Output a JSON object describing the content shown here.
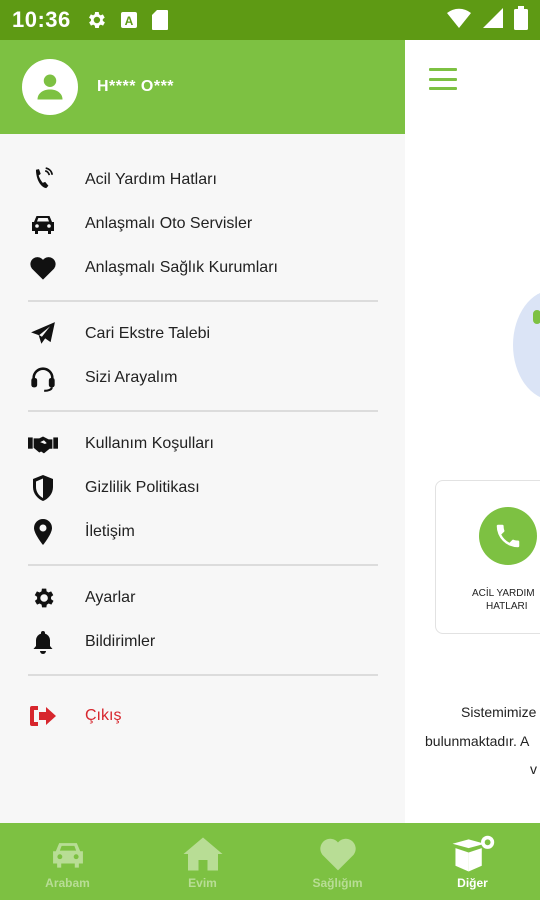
{
  "status_bar": {
    "time": "10:36",
    "icons": [
      "gear-icon",
      "a-badge-icon",
      "sd-card-icon",
      "wifi-icon",
      "signal-icon",
      "battery-icon"
    ]
  },
  "colors": {
    "brand_green": "#7dc142",
    "status_green": "#5e9a14",
    "logout_red": "#d7262d",
    "drawer_bg": "#f7f7f7"
  },
  "drawer": {
    "user_name": "H**** O***",
    "groups": [
      [
        {
          "label": "Acil Yardım Hatları",
          "icon": "phone-ring-icon"
        },
        {
          "label": "Anlaşmalı Oto Servisler",
          "icon": "car-icon"
        },
        {
          "label": "Anlaşmalı Sağlık Kurumları",
          "icon": "heart-icon"
        }
      ],
      [
        {
          "label": "Cari Ekstre Talebi",
          "icon": "paper-plane-icon"
        },
        {
          "label": "Sizi Arayalım",
          "icon": "headset-icon"
        }
      ],
      [
        {
          "label": "Kullanım Koşulları",
          "icon": "handshake-icon"
        },
        {
          "label": "Gizlilik Politikası",
          "icon": "shield-icon"
        },
        {
          "label": "İletişim",
          "icon": "location-pin-icon"
        }
      ],
      [
        {
          "label": "Ayarlar",
          "icon": "gear-icon"
        },
        {
          "label": "Bildirimler",
          "icon": "bell-icon"
        }
      ],
      [
        {
          "label": "Çıkış",
          "icon": "logout-icon"
        }
      ]
    ]
  },
  "main": {
    "card_label_line1": "ACİL YARDIM",
    "card_label_line2": "HATLARI",
    "paragraph_lines": [
      "Sistemimize",
      "bulunmaktadır. A",
      "v"
    ]
  },
  "bottom_nav": {
    "tabs": [
      {
        "label": "Arabam",
        "icon": "car-icon",
        "active": false
      },
      {
        "label": "Evim",
        "icon": "house-icon",
        "active": false
      },
      {
        "label": "Sağlığım",
        "icon": "heart-icon",
        "active": false
      },
      {
        "label": "Diğer",
        "icon": "box-icon",
        "active": true
      }
    ]
  }
}
